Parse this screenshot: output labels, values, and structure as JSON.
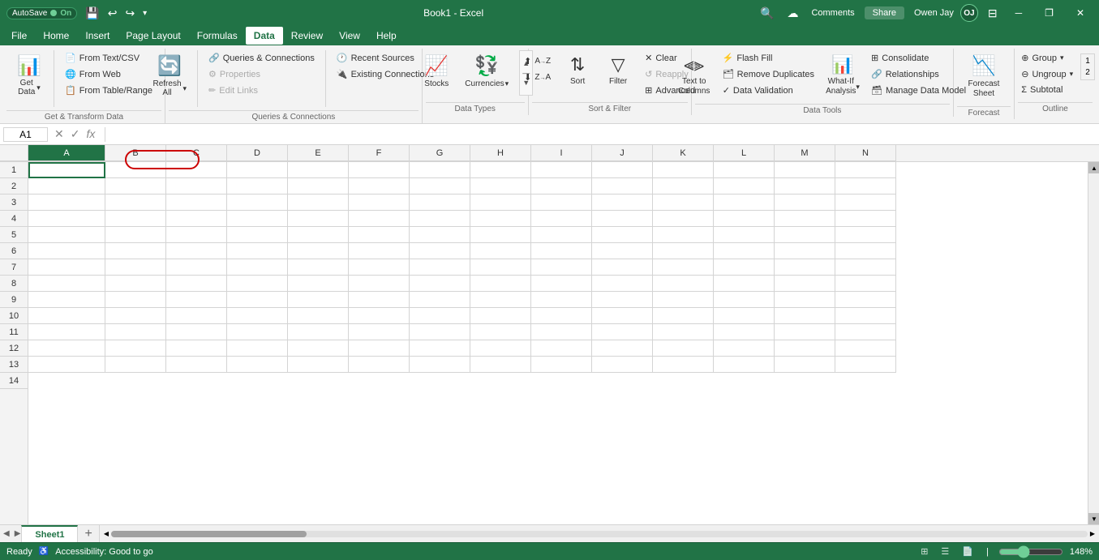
{
  "titleBar": {
    "autosave_label": "AutoSave",
    "autosave_state": "On",
    "app_name": "Book1 - Excel",
    "user_name": "Owen Jay",
    "user_initials": "OJ",
    "quick_access": [
      "💾",
      "↩",
      "↪"
    ],
    "window_controls": [
      "─",
      "❐",
      "✕"
    ]
  },
  "menuBar": {
    "items": [
      {
        "label": "File",
        "active": false
      },
      {
        "label": "Home",
        "active": false
      },
      {
        "label": "Insert",
        "active": false
      },
      {
        "label": "Page Layout",
        "active": false
      },
      {
        "label": "Formulas",
        "active": false
      },
      {
        "label": "Data",
        "active": true
      },
      {
        "label": "Review",
        "active": false
      },
      {
        "label": "View",
        "active": false
      },
      {
        "label": "Help",
        "active": false
      }
    ]
  },
  "ribbon": {
    "groups": [
      {
        "name": "get-transform",
        "label": "Get & Transform Data",
        "buttons": [
          {
            "id": "get-data",
            "icon": "📊",
            "label": "Get\nData",
            "hasDropdown": true,
            "large": true
          },
          {
            "id": "from-text-csv",
            "icon": "📄",
            "label": "From Text/CSV",
            "small": true
          },
          {
            "id": "from-web",
            "icon": "🌐",
            "label": "From Web",
            "small": true,
            "highlighted": true
          },
          {
            "id": "from-table",
            "icon": "📋",
            "label": "From Table/Range",
            "small": true
          }
        ]
      },
      {
        "name": "queries-connections",
        "label": "Queries & Connections",
        "buttons": [
          {
            "id": "refresh-all",
            "icon": "🔄",
            "label": "Refresh\nAll",
            "hasDropdown": true,
            "large": true
          },
          {
            "id": "queries-connections",
            "icon": "🔗",
            "label": "Queries & Connections",
            "small": true
          },
          {
            "id": "properties",
            "icon": "⚙",
            "label": "Properties",
            "small": true,
            "disabled": true
          },
          {
            "id": "edit-links",
            "icon": "✏",
            "label": "Edit Links",
            "small": true,
            "disabled": true
          }
        ]
      },
      {
        "name": "recent-existing",
        "label": "",
        "right_buttons": [
          {
            "id": "recent-sources",
            "icon": "🕐",
            "label": "Recent Sources"
          },
          {
            "id": "existing-connections",
            "icon": "🔌",
            "label": "Existing Connections"
          }
        ]
      },
      {
        "name": "data-types",
        "label": "Data Types",
        "buttons": [
          {
            "id": "stocks",
            "icon": "📈",
            "label": "Stocks",
            "large": true
          },
          {
            "id": "currencies",
            "icon": "💱",
            "label": "Currencies",
            "large": true,
            "hasDropdown": true
          }
        ]
      },
      {
        "name": "sort-filter",
        "label": "Sort & Filter",
        "buttons": [
          {
            "id": "sort-az",
            "icon": "↑",
            "label": "A→Z",
            "small": true
          },
          {
            "id": "sort-za",
            "icon": "↓",
            "label": "Z→A",
            "small": true
          },
          {
            "id": "sort",
            "icon": "⇅",
            "label": "Sort",
            "large": true
          },
          {
            "id": "filter",
            "icon": "▽",
            "label": "Filter",
            "large": true
          },
          {
            "id": "clear",
            "icon": "✕",
            "label": "Clear",
            "small": true
          },
          {
            "id": "reapply",
            "icon": "↺",
            "label": "Reapply",
            "small": true,
            "disabled": true
          },
          {
            "id": "advanced",
            "icon": "⊞",
            "label": "Advanced",
            "small": true
          }
        ]
      },
      {
        "name": "data-tools",
        "label": "Data Tools",
        "buttons": [
          {
            "id": "text-to-columns",
            "icon": "⫷",
            "label": "Text to\nColumns",
            "large": true
          },
          {
            "id": "what-if",
            "icon": "📊",
            "label": "What-If\nAnalysis",
            "hasDropdown": true,
            "large": true
          },
          {
            "id": "flash-fill",
            "icon": "⚡",
            "label": "",
            "small": true
          },
          {
            "id": "remove-dups",
            "icon": "🗂",
            "label": "",
            "small": true
          },
          {
            "id": "data-validation",
            "icon": "✓",
            "label": "",
            "small": true
          },
          {
            "id": "consolidate",
            "icon": "⊞",
            "label": "",
            "small": true
          },
          {
            "id": "relationships",
            "icon": "🔗",
            "label": "",
            "small": true
          }
        ]
      },
      {
        "name": "forecast",
        "label": "Forecast",
        "buttons": [
          {
            "id": "forecast-sheet",
            "icon": "📉",
            "label": "Forecast\nSheet",
            "large": true
          }
        ]
      },
      {
        "name": "outline",
        "label": "Outline",
        "buttons": [
          {
            "id": "group",
            "icon": "⊕",
            "label": "Group",
            "hasDropdown": true,
            "small": true
          },
          {
            "id": "ungroup",
            "icon": "⊖",
            "label": "Ungroup",
            "hasDropdown": true,
            "small": true
          },
          {
            "id": "subtotal",
            "icon": "Σ",
            "label": "Subtotal",
            "small": true
          }
        ]
      }
    ]
  },
  "formulaBar": {
    "cell_ref": "A1",
    "formula_value": ""
  },
  "spreadsheet": {
    "columns": [
      "A",
      "B",
      "C",
      "D",
      "E",
      "F",
      "G",
      "H",
      "I",
      "J",
      "K",
      "L",
      "M",
      "N"
    ],
    "rows": 13,
    "active_cell": "A1"
  },
  "sheetTabs": {
    "sheets": [
      {
        "label": "Sheet1",
        "active": true
      }
    ],
    "add_label": "+"
  },
  "statusBar": {
    "ready_text": "Ready",
    "accessibility_text": "Accessibility: Good to go",
    "zoom_level": "148%",
    "view_buttons": [
      "⊞",
      "☰",
      "📄"
    ]
  }
}
